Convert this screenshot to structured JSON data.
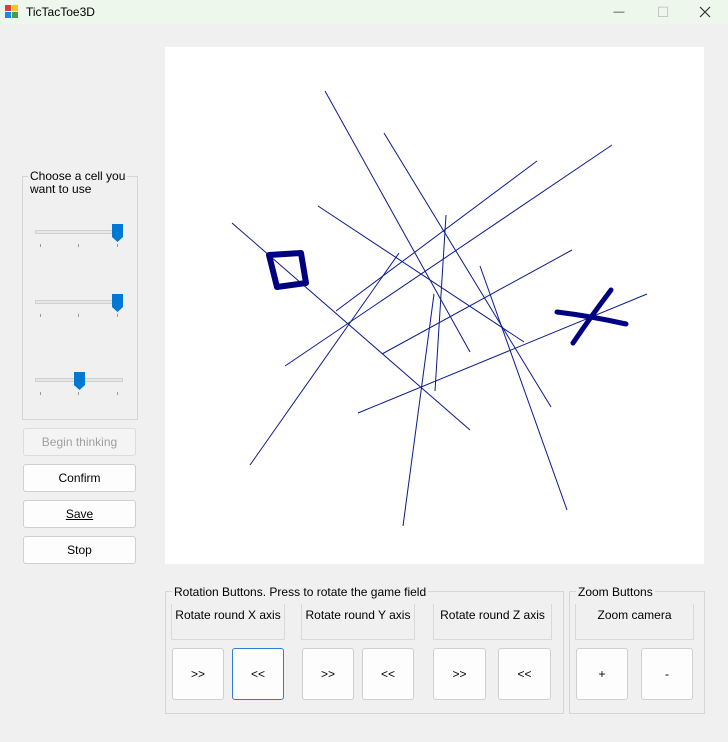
{
  "window": {
    "title": "TicTacToe3D",
    "minimize_glyph": "—",
    "maximize_glyph": "☐"
  },
  "cell_chooser": {
    "label": "Choose a cell you want to use",
    "label_line1": "Choose a cell you",
    "label_line2": "want to use",
    "sliders": [
      {
        "name": "x-cell-slider",
        "value": 2,
        "min": 0,
        "max": 2
      },
      {
        "name": "y-cell-slider",
        "value": 2,
        "min": 0,
        "max": 2
      },
      {
        "name": "z-cell-slider",
        "value": 1,
        "min": 0,
        "max": 2
      }
    ]
  },
  "actions": {
    "begin_thinking": "Begin thinking",
    "confirm": "Confirm",
    "save": "Save",
    "stop": "Stop"
  },
  "rotation": {
    "group_label": "Rotation Buttons. Press to rotate the game field",
    "x_label": "Rotate round X axis",
    "y_label": "Rotate round Y axis",
    "z_label": "Rotate round Z axis",
    "forward": ">>",
    "backward": "<<"
  },
  "zoom": {
    "group_label": "Zoom Buttons",
    "camera_label": "Zoom camera",
    "plus": "+",
    "minus": "-"
  },
  "colors": {
    "line": "#0a1a8c",
    "mark": "#000080",
    "accent": "#0078d4"
  }
}
